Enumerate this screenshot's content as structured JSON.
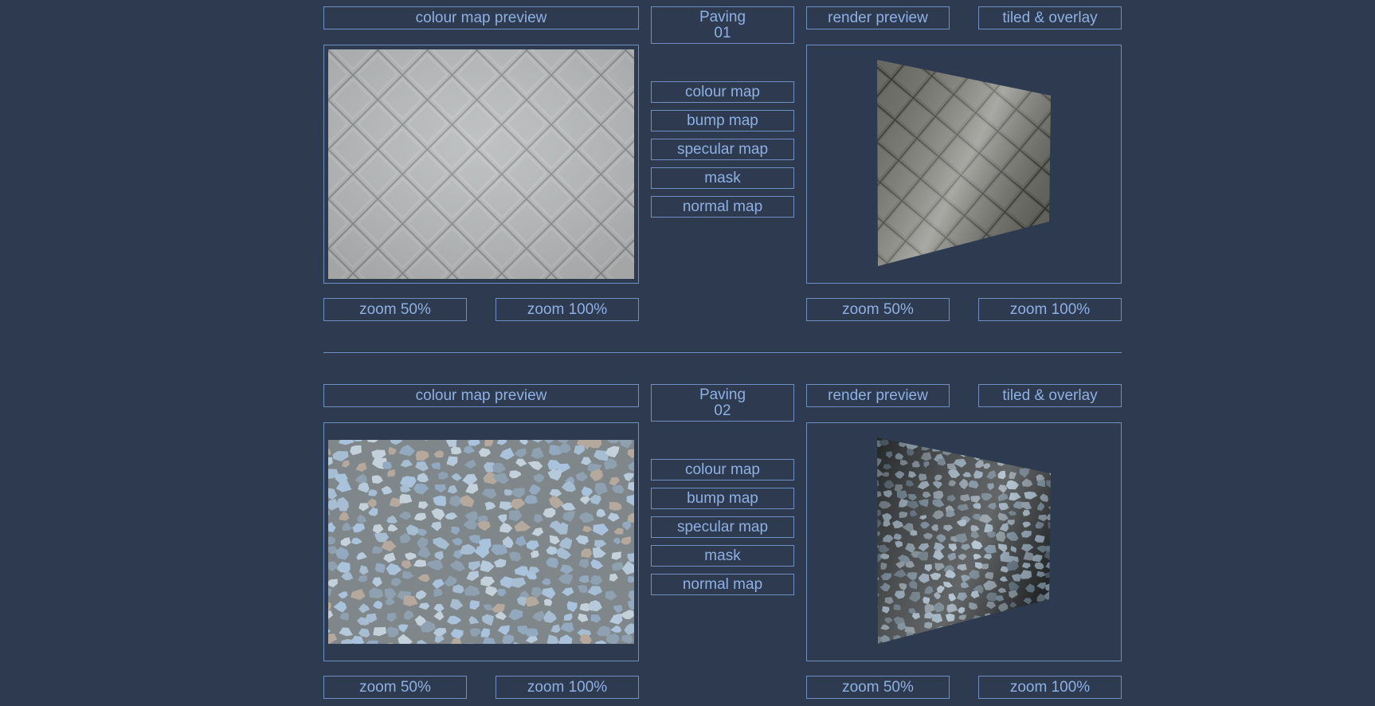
{
  "sections": [
    {
      "title_line1": "Paving",
      "title_line2": "01",
      "colour_map_preview": "colour map preview",
      "render_preview": "render preview",
      "tiled_overlay": "tiled & overlay",
      "map_buttons": [
        "colour map",
        "bump map",
        "specular map",
        "mask",
        "normal map"
      ],
      "left_zoom": [
        "zoom 50%",
        "zoom 100%"
      ],
      "right_zoom": [
        "zoom 50%",
        "zoom 100%"
      ],
      "texture": "square-tiles",
      "texture_colors": {
        "base": "#b9bcbc",
        "grout": "#8f9293",
        "render_base": "#6a6a62",
        "render_light": "#b9bab4"
      }
    },
    {
      "title_line1": "Paving",
      "title_line2": "02",
      "colour_map_preview": "colour map preview",
      "render_preview": "render preview",
      "tiled_overlay": "tiled & overlay",
      "map_buttons": [
        "colour map",
        "bump map",
        "specular map",
        "mask",
        "normal map"
      ],
      "left_zoom": [
        "zoom 50%",
        "zoom 100%"
      ],
      "right_zoom": [
        "zoom 50%",
        "zoom 100%"
      ],
      "texture": "cobblestones",
      "texture_colors": {
        "base": "#7d8589",
        "stone": "#a9c0d6",
        "render_base": "#3c4042",
        "render_light": "#9bb0c2"
      }
    }
  ]
}
